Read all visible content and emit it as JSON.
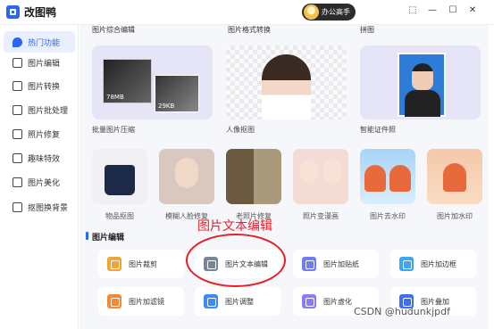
{
  "app": {
    "title": "改图鸭",
    "user": "办公高手"
  },
  "window": {
    "minimize": "—",
    "maximize": "☐",
    "close": "✕",
    "skin": "⬚"
  },
  "sidebar": {
    "items": [
      {
        "label": "热门功能",
        "icon": "fire-icon"
      },
      {
        "label": "图片编辑",
        "icon": "image-edit-icon"
      },
      {
        "label": "图片转换",
        "icon": "convert-icon"
      },
      {
        "label": "图片批处理",
        "icon": "batch-icon"
      },
      {
        "label": "照片修复",
        "icon": "repair-icon"
      },
      {
        "label": "趣味特效",
        "icon": "effects-icon"
      },
      {
        "label": "图片美化",
        "icon": "beautify-icon"
      },
      {
        "label": "抠图换背景",
        "icon": "cutout-icon"
      }
    ]
  },
  "top_row": [
    "图片综合编辑",
    "图片格式转换",
    "拼图"
  ],
  "features": [
    {
      "label": "批量图片压缩",
      "size_before": "78MB",
      "size_after": "29KB"
    },
    {
      "label": "人像抠图"
    },
    {
      "label": "智能证件照"
    }
  ],
  "thumbs": [
    "物品抠图",
    "模糊人脸修复",
    "老照片修复",
    "照片变漫画",
    "图片去水印",
    "图片加水印"
  ],
  "section": {
    "title": "图片编辑"
  },
  "tools": [
    {
      "label": "图片裁剪",
      "color": "#f0a53a"
    },
    {
      "label": "图片文本编辑",
      "color": "#7a8597"
    },
    {
      "label": "图片加贴纸",
      "color": "#6f7df0"
    },
    {
      "label": "图片加边框",
      "color": "#3fa5f0"
    },
    {
      "label": "图片加滤镜",
      "color": "#f08a3a"
    },
    {
      "label": "图片调整",
      "color": "#3f8af0"
    },
    {
      "label": "图片虚化",
      "color": "#8a7df0"
    },
    {
      "label": "图片叠加",
      "color": "#3f6ff0"
    }
  ],
  "annotation": {
    "text": "图片文本编辑"
  },
  "watermark": "CSDN @hudunkjpdf"
}
